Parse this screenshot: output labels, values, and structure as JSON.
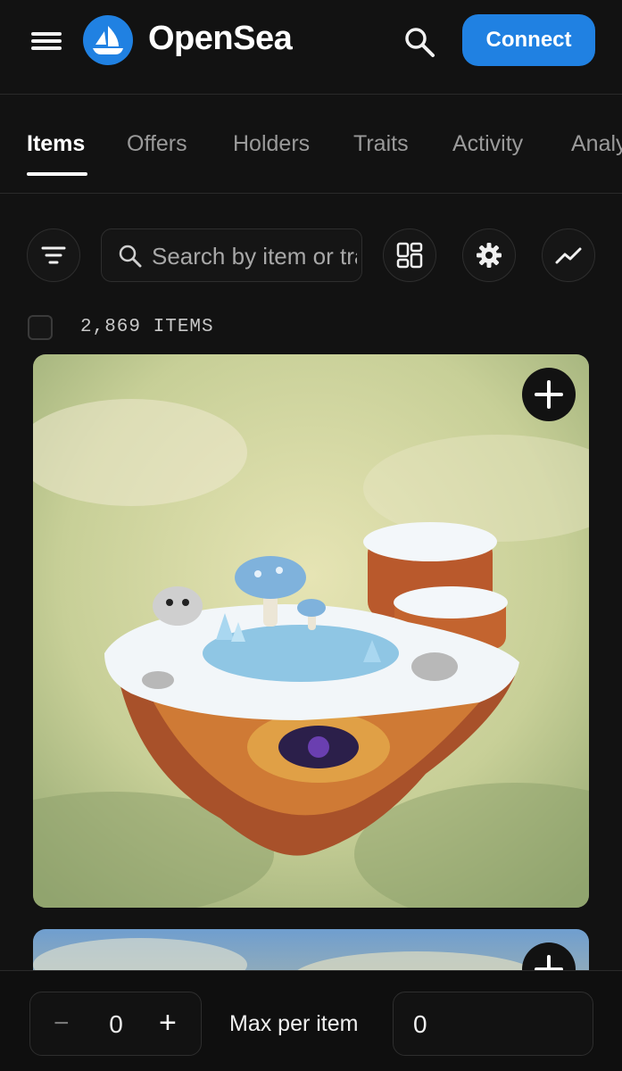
{
  "header": {
    "brand": "OpenSea",
    "connect_label": "Connect",
    "accent_color": "#2081e2"
  },
  "tabs": [
    {
      "label": "Items",
      "active": true
    },
    {
      "label": "Offers",
      "active": false
    },
    {
      "label": "Holders",
      "active": false
    },
    {
      "label": "Traits",
      "active": false
    },
    {
      "label": "Activity",
      "active": false
    },
    {
      "label": "Analy",
      "active": false
    }
  ],
  "toolbar": {
    "search_placeholder": "Search by item or trait",
    "icons": [
      "filter-icon",
      "search-icon",
      "grid-layout-icon",
      "gear-icon",
      "trending-chart-icon"
    ]
  },
  "items": {
    "count_label": "2,869 ITEMS",
    "cards": [
      {
        "image": "floating-snow-island-artwork",
        "add_icon": "plus-icon"
      },
      {
        "image": "sky-artwork",
        "add_icon": "plus-icon"
      }
    ]
  },
  "bottom_bar": {
    "minus_symbol": "−",
    "quantity": "0",
    "plus_symbol": "+",
    "max_label": "Max per item",
    "max_value": "0"
  }
}
